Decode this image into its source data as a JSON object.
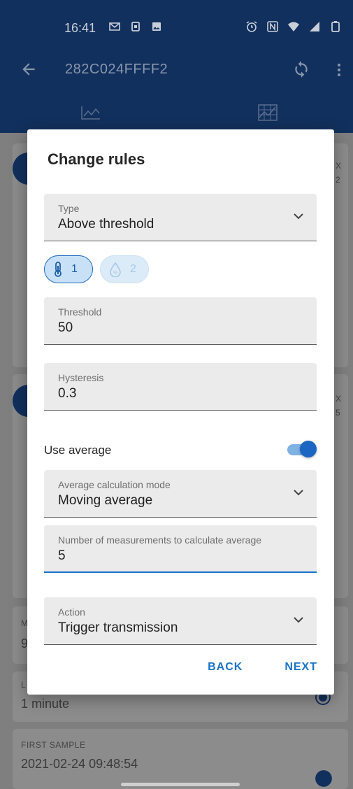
{
  "status_bar": {
    "time": "16:41",
    "left_icons": [
      "gmail-icon",
      "sim-icon",
      "image-icon"
    ],
    "right_icons": [
      "alarm-icon",
      "nfc-icon",
      "wifi-icon",
      "signal-icon",
      "battery-icon"
    ]
  },
  "app_bar": {
    "title": "282C024FFFF2"
  },
  "background": {
    "rows": [
      {
        "label": "M",
        "value": "9"
      },
      {
        "label": "L",
        "value": "1 minute"
      },
      {
        "label": "FIRST SAMPLE",
        "value": "2021-02-24  09:48:54"
      }
    ],
    "side_glyphs": [
      "X",
      "2",
      "X",
      "5"
    ]
  },
  "dialog": {
    "title": "Change rules",
    "type_field": {
      "label": "Type",
      "value": "Above threshold"
    },
    "chips": [
      {
        "value": "1",
        "icon": "thermometer-icon",
        "selected": true
      },
      {
        "value": "2",
        "icon": "humidity-icon",
        "selected": false
      }
    ],
    "threshold_field": {
      "label": "Threshold",
      "value": "50"
    },
    "hysteresis_field": {
      "label": "Hysteresis",
      "value": "0.3"
    },
    "use_average": {
      "label": "Use average",
      "enabled": true
    },
    "avg_mode_field": {
      "label": "Average calculation mode",
      "value": "Moving average"
    },
    "num_measurements_field": {
      "label": "Number of measurements to calculate average",
      "value": "5"
    },
    "action_field": {
      "label": "Action",
      "value": "Trigger transmission"
    },
    "back_label": "BACK",
    "next_label": "NEXT"
  },
  "colors": {
    "primary": "#12305d",
    "accent": "#1a73c8"
  }
}
